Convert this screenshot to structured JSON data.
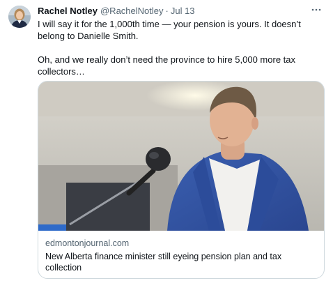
{
  "tweet": {
    "author": {
      "name": "Rachel Notley",
      "handle": "@RachelNotley",
      "separator": "·",
      "date": "Jul 13"
    },
    "more_icon": "more-horizontal-icon",
    "paragraphs": [
      "I will say it for the 1,000th time — your pension is yours. It doesn’t belong to Danielle Smith.",
      "Oh, and we really don’t need the province to hire 5,000 more tax collectors…"
    ],
    "card": {
      "domain": "edmontonjournal.com",
      "headline": "New Alberta finance minister still eyeing pension plan and tax collection"
    }
  }
}
